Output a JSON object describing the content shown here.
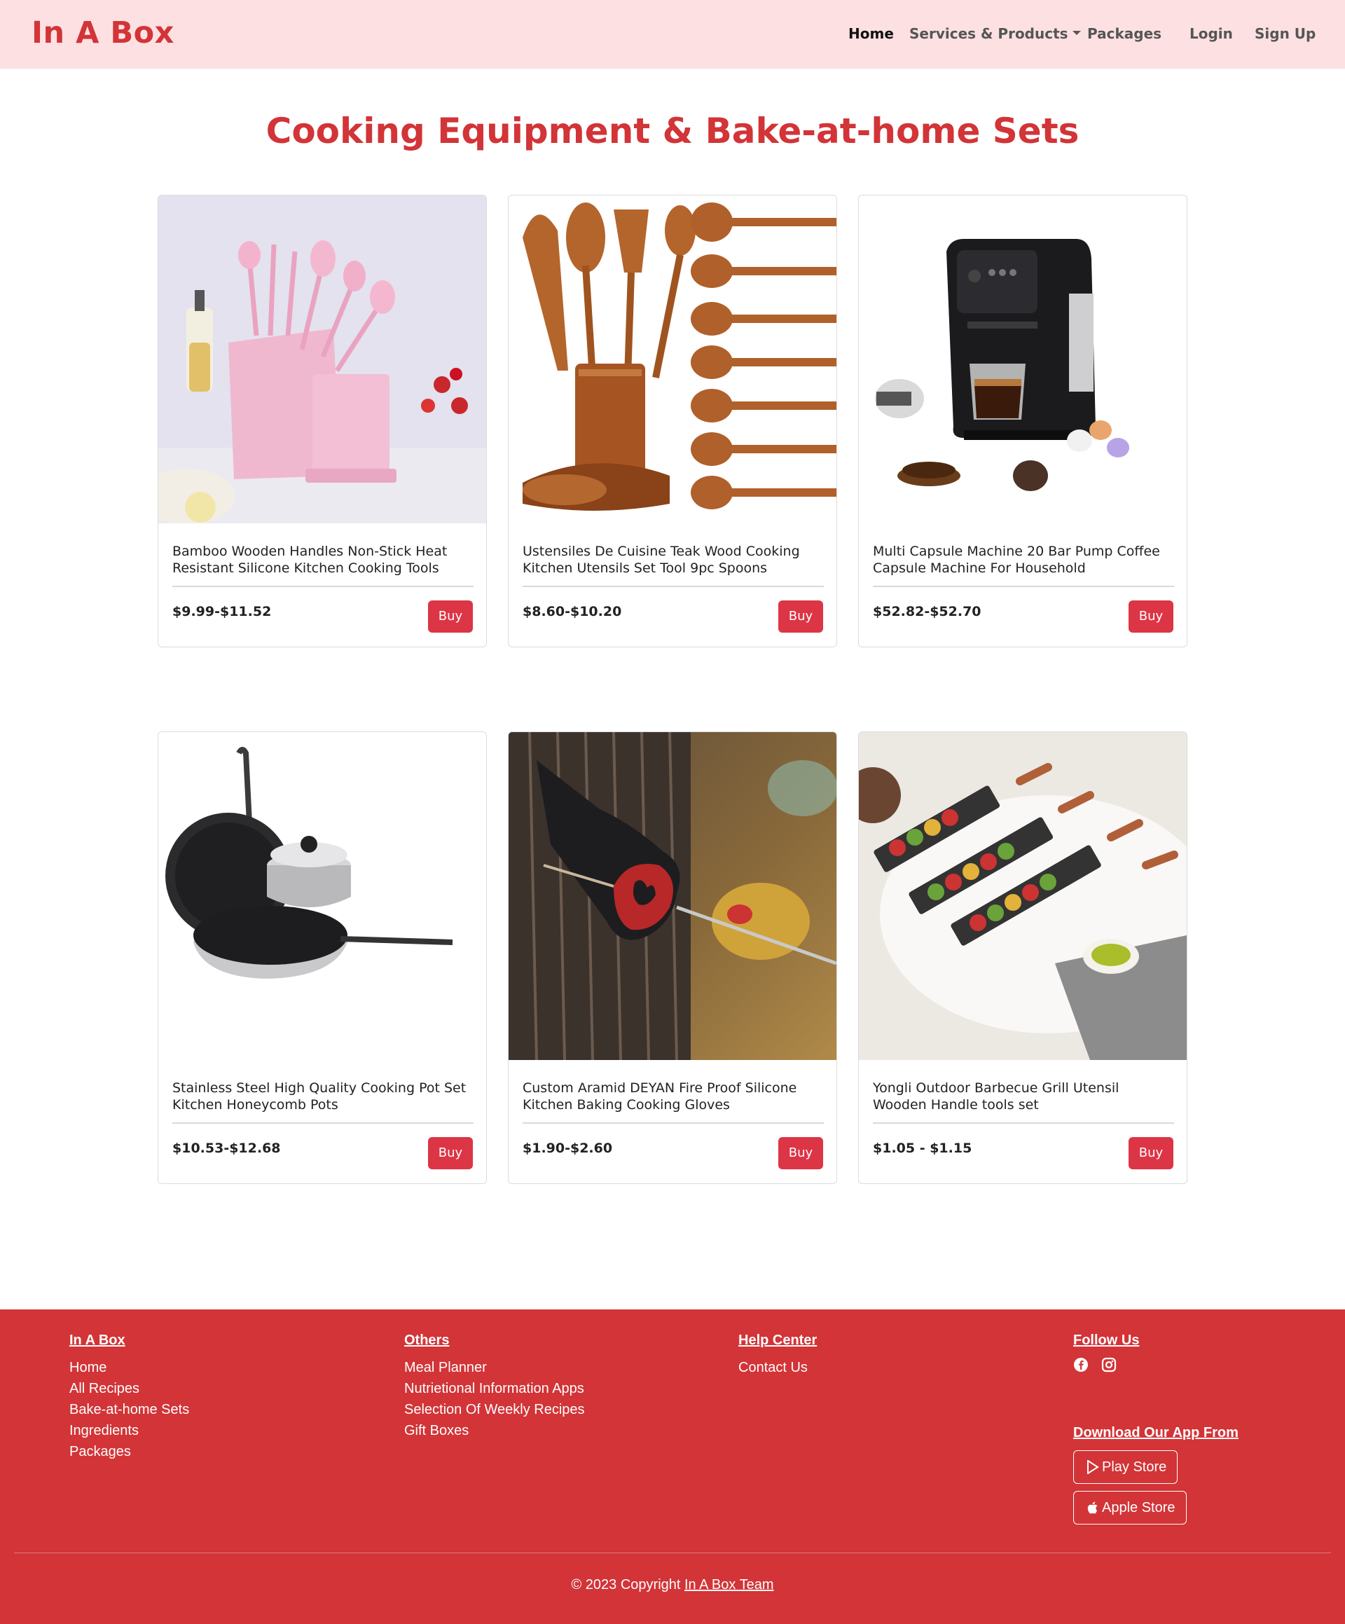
{
  "navbar": {
    "brand": "In A Box",
    "items": [
      {
        "label": "Home"
      },
      {
        "label": "Services & Products"
      },
      {
        "label": "Packages"
      },
      {
        "label": "Login"
      },
      {
        "label": "Sign Up"
      }
    ]
  },
  "page": {
    "title": "Cooking Equipment & Bake-at-home Sets"
  },
  "products": [
    {
      "title": "Bamboo Wooden Handles Non-Stick Heat Resistant Silicone Kitchen Cooking Tools",
      "price": "$9.99-$11.52",
      "buy_label": "Buy"
    },
    {
      "title": "Ustensiles De Cuisine Teak Wood Cooking Kitchen Utensils Set Tool 9pc Spoons",
      "price": "$8.60-$10.20",
      "buy_label": "Buy"
    },
    {
      "title": "Multi Capsule Machine 20 Bar Pump Coffee Capsule Machine For Household",
      "price": "$52.82-$52.70",
      "buy_label": "Buy"
    },
    {
      "title": "Stainless Steel High Quality Cooking Pot Set Kitchen Honeycomb Pots",
      "price": "$10.53-$12.68",
      "buy_label": "Buy"
    },
    {
      "title": "Custom Aramid DEYAN Fire Proof Silicone Kitchen Baking Cooking Gloves",
      "price": "$1.90-$2.60",
      "buy_label": "Buy"
    },
    {
      "title": "Yongli Outdoor Barbecue Grill Utensil Wooden Handle tools set",
      "price": "$1.05 - $1.15",
      "buy_label": "Buy"
    }
  ],
  "footer": {
    "col1": {
      "heading": "In A Box",
      "links": [
        "Home",
        "All Recipes",
        "Bake-at-home Sets",
        "Ingredients",
        "Packages"
      ]
    },
    "col2": {
      "heading": "Others",
      "links": [
        "Meal Planner",
        "Nutrietional Information Apps",
        "Selection Of Weekly Recipes",
        "Gift Boxes"
      ]
    },
    "col3": {
      "heading": "Help Center",
      "links": [
        "Contact Us"
      ]
    },
    "col4": {
      "heading": "Follow Us",
      "icons": [
        "facebook-icon",
        "instagram-icon"
      ]
    },
    "download_heading": "Download Our App From",
    "play_store": "Play Store",
    "apple_store": "Apple Store",
    "copyright_prefix": "© 2023 Copyright",
    "copyright_link": "In A Box Team"
  },
  "colors": {
    "brand": "#d23437",
    "navbar_bg": "#fde0e2",
    "buy_button": "#dc3545"
  }
}
